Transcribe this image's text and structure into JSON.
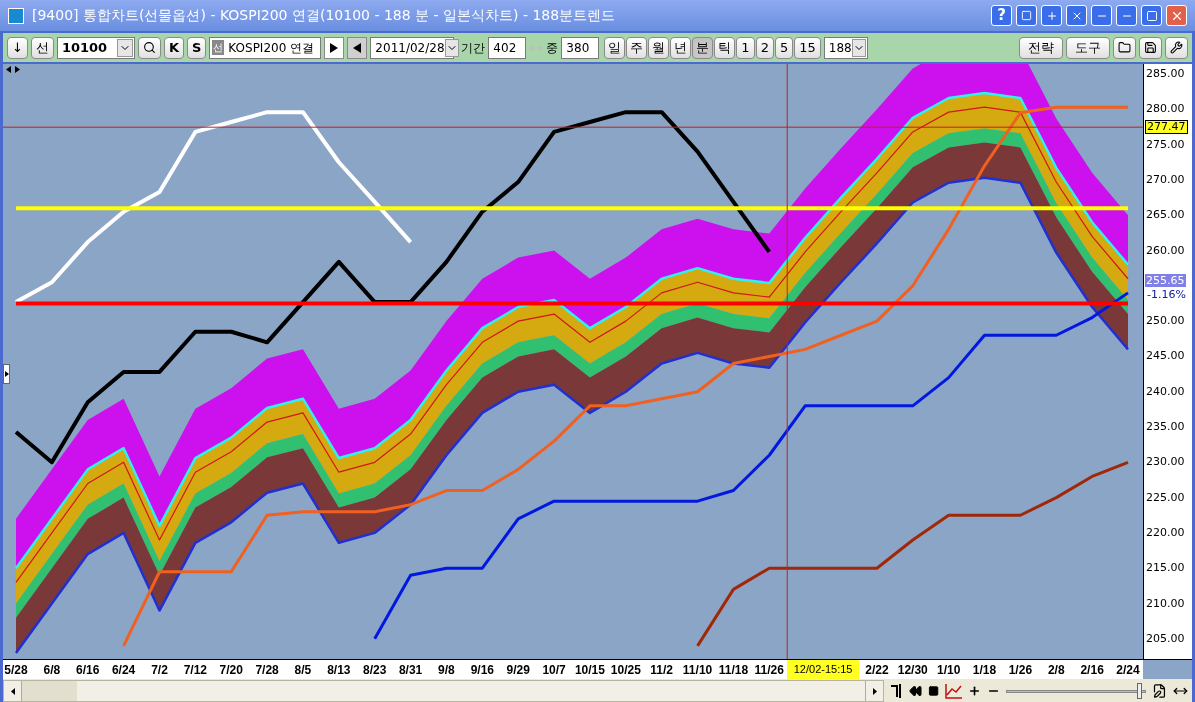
{
  "window": {
    "title": "[9400] 통합차트(선물옵션) - KOSPI200 연결(10100 - 188 분 - 일본식차트) - 188분트렌드",
    "help_button": "?"
  },
  "toolbar": {
    "down_button": "↓",
    "market_button": "선",
    "code_field": "10100",
    "k_button": "K",
    "s_button": "S",
    "instrument_badge": "선",
    "instrument_name": "KOSPI200 연결",
    "date_field": "2011/02/28",
    "period_label": "기간",
    "period_field": "402",
    "overlap_label": "중",
    "overlap_field": "380",
    "period_types": [
      {
        "label": "일",
        "selected": false
      },
      {
        "label": "주",
        "selected": false
      },
      {
        "label": "월",
        "selected": false
      },
      {
        "label": "년",
        "selected": false
      },
      {
        "label": "분",
        "selected": true
      },
      {
        "label": "틱",
        "selected": false
      }
    ],
    "intervals": [
      "1",
      "2",
      "5",
      "15"
    ],
    "interval_field": "188",
    "strategy_button": "전략",
    "tools_button": "도구"
  },
  "chart": {
    "line_styles": [
      {
        "kind": "thin"
      },
      {
        "kind": "medium"
      },
      {
        "kind": "medium"
      },
      {
        "kind": "thick"
      },
      {
        "kind": "thick"
      },
      {
        "kind": "step"
      },
      {
        "kind": "step"
      },
      {
        "kind": "step"
      },
      {
        "kind": "rule"
      },
      {
        "kind": "rule"
      }
    ],
    "crosshair_price": "277.47",
    "crosshair_time": "12/02-15:15",
    "last_price": "255.65",
    "change": "-1.16%",
    "chart_data": {
      "type": "line",
      "ylim": [
        202.14,
        286.42
      ],
      "categories": [
        "5/28",
        "6/8",
        "6/16",
        "6/24",
        "7/2",
        "7/12",
        "7/20",
        "7/28",
        "8/5",
        "8/13",
        "8/23",
        "8/31",
        "9/8",
        "9/16",
        "9/29",
        "10/7",
        "10/15",
        "10/25",
        "11/2",
        "11/10",
        "11/18",
        "11/26",
        null,
        null,
        "2/22",
        "12/30",
        "1/10",
        "1/18",
        "1/26",
        "2/8",
        "2/16",
        "2/24"
      ],
      "yticks": [
        {
          "value": 285,
          "label": "285.00"
        },
        {
          "value": 280,
          "label": "280.00"
        },
        {
          "value": 275,
          "label": "275.00"
        },
        {
          "value": 270,
          "label": "270.00"
        },
        {
          "value": 265,
          "label": "265.00"
        },
        {
          "value": 260,
          "label": "260.00"
        },
        {
          "value": 250,
          "label": "250.00"
        },
        {
          "value": 245,
          "label": "245.00"
        },
        {
          "value": 240,
          "label": "240.00"
        },
        {
          "value": 235,
          "label": "235.00"
        },
        {
          "value": 230,
          "label": "230.00"
        },
        {
          "value": 225,
          "label": "225.00"
        },
        {
          "value": 220,
          "label": "220.00"
        },
        {
          "value": 215,
          "label": "215.00"
        },
        {
          "value": 210,
          "label": "210.00"
        },
        {
          "value": 205,
          "label": "205.00"
        }
      ],
      "series": [
        {
          "color": "#d01818",
          "values": [
            213,
            220,
            227,
            230,
            219,
            228.6,
            231.5,
            235.7,
            237,
            228.6,
            230,
            234,
            241,
            247,
            250,
            251,
            247,
            250,
            254,
            255.5,
            254,
            253.4,
            259.8,
            265.5,
            271,
            276.8,
            279.6,
            280.3,
            279.6,
            269.7,
            262,
            256
          ]
        },
        {
          "color": "#30f0f0",
          "values": [
            215,
            222,
            229,
            232,
            221,
            230.6,
            233.5,
            237.7,
            239,
            230.6,
            232,
            236,
            243,
            249,
            252,
            253,
            249,
            252,
            256,
            257.5,
            256,
            255.4,
            261.8,
            267.5,
            273,
            278.8,
            281.6,
            282.3,
            281.6,
            271.7,
            264,
            258
          ]
        },
        {
          "color": "#2030d0",
          "values": [
            203,
            210,
            217,
            220,
            209,
            218.6,
            221.5,
            225.7,
            227,
            218.6,
            220,
            224,
            231,
            237,
            240,
            241,
            237,
            240,
            244,
            245.5,
            244,
            243.4,
            249.8,
            255.5,
            261,
            266.8,
            269.6,
            270.3,
            269.6,
            259.7,
            252,
            246
          ]
        },
        {
          "color": "#ffffff",
          "values": [
            252.7,
            255.5,
            261.2,
            265.5,
            268.3,
            276.8,
            278.2,
            279.6,
            279.6,
            272.5,
            266.9,
            261.2,
            null,
            null,
            null,
            null,
            null,
            null,
            null,
            null,
            null,
            null,
            null,
            null,
            null,
            null,
            null,
            null,
            null,
            null,
            null,
            null
          ]
        },
        {
          "color": "#000000",
          "values": [
            234.3,
            230,
            238.5,
            242.8,
            242.8,
            248.5,
            248.5,
            247,
            252.7,
            258.4,
            252.7,
            252.7,
            258.4,
            265.5,
            269.7,
            276.8,
            278.2,
            279.6,
            279.6,
            274,
            266.9,
            259.8,
            null,
            null,
            null,
            null,
            null,
            null,
            null,
            null,
            null,
            null
          ]
        },
        {
          "color": "#f06020",
          "values": [
            null,
            null,
            null,
            204,
            214.5,
            214.5,
            214.5,
            222.5,
            223,
            223,
            223,
            224,
            226,
            226,
            229,
            233,
            238,
            238,
            239,
            240,
            244,
            245,
            246,
            248,
            250,
            255,
            263,
            272,
            279.5,
            280.3,
            280.3,
            280.3
          ]
        },
        {
          "color": "#0018e0",
          "values": [
            null,
            null,
            null,
            null,
            null,
            null,
            null,
            null,
            null,
            null,
            205,
            214,
            215,
            215,
            222,
            224.5,
            224.5,
            224.5,
            224.5,
            224.5,
            226,
            231,
            238,
            238,
            238,
            238,
            242,
            248,
            248,
            248,
            250.5,
            254
          ]
        },
        {
          "color": "#a02808",
          "values": [
            null,
            null,
            null,
            null,
            null,
            null,
            null,
            null,
            null,
            null,
            null,
            null,
            null,
            null,
            null,
            null,
            null,
            null,
            null,
            204,
            212,
            215,
            215,
            215,
            215,
            219,
            222.5,
            222.5,
            222.5,
            225,
            228,
            230
          ]
        },
        {
          "color": "#ffff00",
          "values": [
            266,
            266,
            266,
            266,
            266,
            266,
            266,
            266,
            266,
            266,
            266,
            266,
            266,
            266,
            266,
            266,
            266,
            266,
            266,
            266,
            266,
            266,
            266,
            266,
            266,
            266,
            266,
            266,
            266,
            266,
            266,
            266
          ]
        },
        {
          "color": "#ff0000",
          "values": [
            252.5,
            252.5,
            252.5,
            252.5,
            252.5,
            252.5,
            252.5,
            252.5,
            252.5,
            252.5,
            252.5,
            252.5,
            252.5,
            252.5,
            252.5,
            252.5,
            252.5,
            252.5,
            252.5,
            252.5,
            252.5,
            252.5,
            252.5,
            252.5,
            252.5,
            252.5,
            252.5,
            252.5,
            252.5,
            252.5,
            252.5,
            252.5
          ]
        }
      ]
    }
  },
  "bottom_bar": {
    "zoom_slider": {
      "level": 0.97
    }
  }
}
